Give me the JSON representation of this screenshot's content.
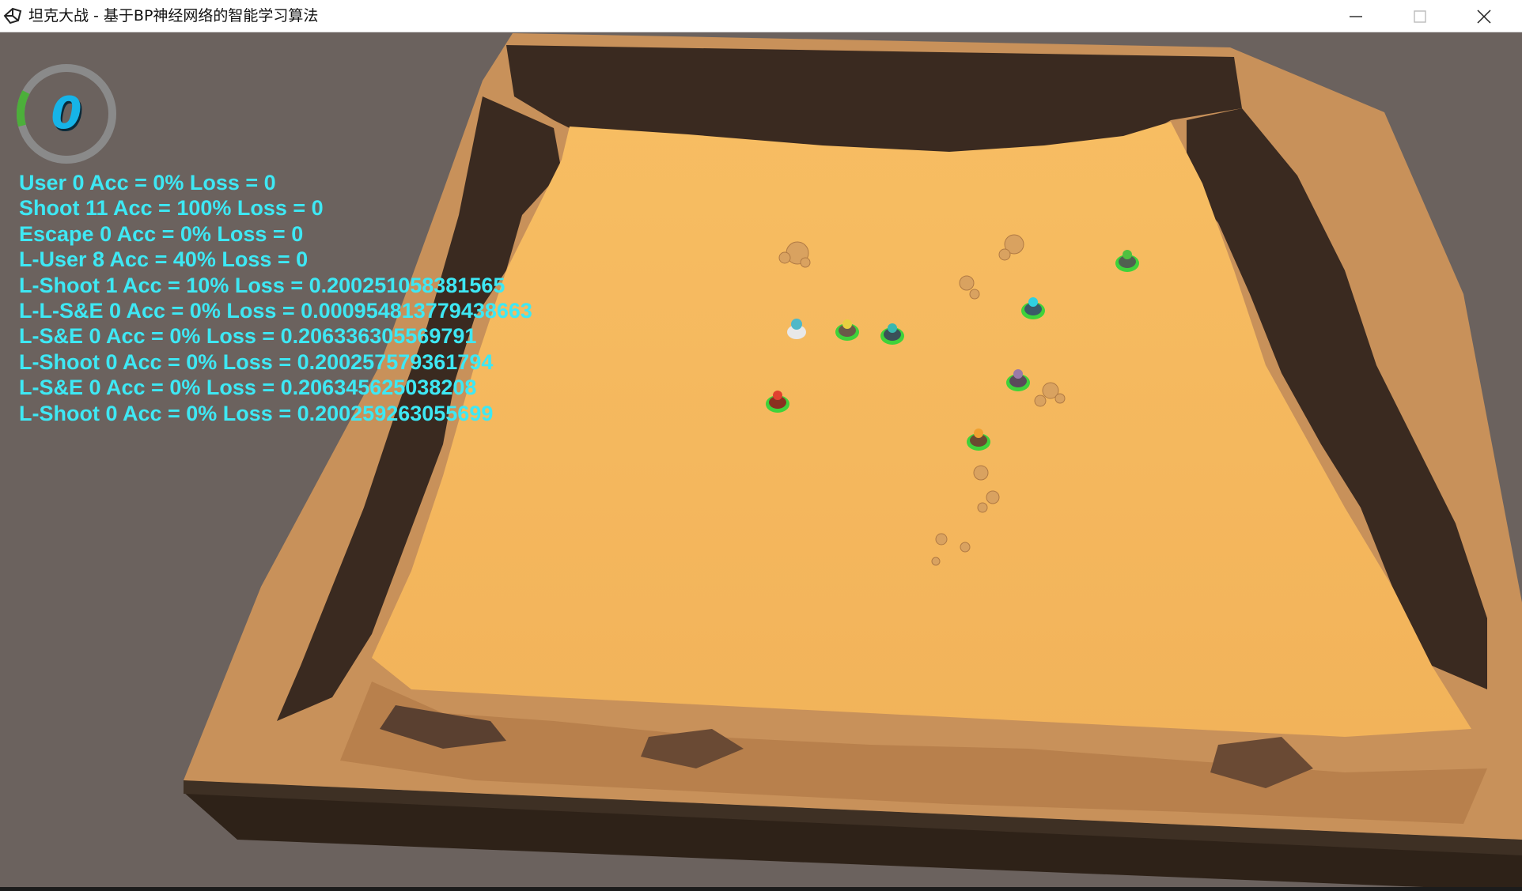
{
  "window": {
    "title": "坦克大战 - 基于BP神经网络的智能学习算法",
    "icon": "unity-logo-icon",
    "controls": [
      "minimize-icon",
      "maximize-icon",
      "close-icon"
    ]
  },
  "hud": {
    "score": "0",
    "score_gauge_progress": 0.12,
    "gauge_colors": {
      "track": "#8a8a8a",
      "fill": "#4caf3a"
    },
    "text_color": "#3ee8f4",
    "stats": [
      "User 0 Acc = 0% Loss = 0",
      "Shoot 11 Acc = 100% Loss = 0",
      "Escape 0 Acc = 0% Loss = 0",
      "L-User 8 Acc = 40% Loss = 0",
      "L-Shoot 1 Acc = 10% Loss = 0.200251058381565",
      "L-L-S&E 0 Acc = 0% Loss = 0.000954813779438663",
      "L-S&E 0 Acc = 0% Loss = 0.206336305569791",
      "L-Shoot 0 Acc = 0% Loss = 0.200257579361794",
      "L-S&E 0 Acc = 0% Loss = 0.206345625038208",
      "L-Shoot 0 Acc = 0% Loss = 0.200259263055699"
    ]
  },
  "scene": {
    "colors": {
      "background": "#6b625e",
      "sand": "#f5b860",
      "rock": "#c8915a",
      "rock_dark": "#3a2a20",
      "ring": "#3fd23a"
    },
    "tanks": [
      {
        "id": "tank-white",
        "body": "#e8e8e8",
        "turret": "#4fb8c8",
        "ring": false
      },
      {
        "id": "tank-yellow",
        "body": "#6a5a48",
        "turret": "#e8d040",
        "ring": true
      },
      {
        "id": "tank-teal",
        "body": "#3a5058",
        "turret": "#38b8b0",
        "ring": true
      },
      {
        "id": "tank-red",
        "body": "#8a3020",
        "turret": "#e04030",
        "ring": true
      },
      {
        "id": "tank-cyan",
        "body": "#3a5a68",
        "turret": "#30d0e0",
        "ring": true
      },
      {
        "id": "tank-purple",
        "body": "#5a4a5a",
        "turret": "#9a7aa8",
        "ring": true
      },
      {
        "id": "tank-orange",
        "body": "#6a4a30",
        "turret": "#f0a030",
        "ring": true
      },
      {
        "id": "tank-green",
        "body": "#506050",
        "turret": "#50c040",
        "ring": true
      }
    ]
  }
}
